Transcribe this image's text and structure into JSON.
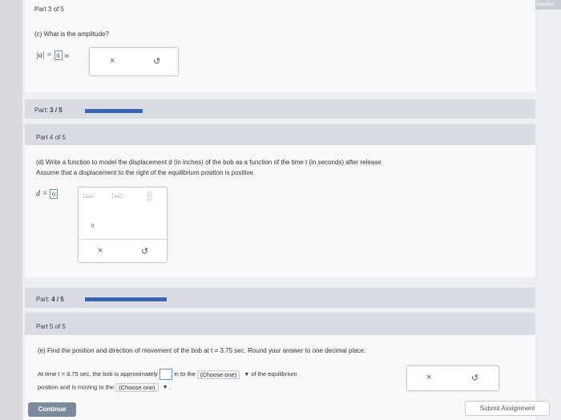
{
  "lang_tab": "Español",
  "part3": {
    "title": "Part 3 of 5",
    "question": "(c) What is the amplitude?",
    "answer_lhs": "|a| =",
    "answer_value": "0",
    "answer_unit": "in"
  },
  "progress1": {
    "label": "Part:",
    "value": "3 / 5",
    "fraction": 0.6
  },
  "part4": {
    "title": "Part 4 of 5",
    "question_line1": "(d) Write a function to model the displacement d (in inches) of the bob as a function of the time t (in seconds) after release.",
    "question_line2": "Assume that a displacement to the right of the equilibrium position is positive.",
    "answer_lhs": "d =",
    "answer_value": "0",
    "pi_symbol": "π"
  },
  "progress2": {
    "label": "Part:",
    "value": "4 / 5",
    "fraction": 0.8
  },
  "part5": {
    "title": "Part 5 of 5",
    "question": "(e) Find the position and direction of movement of the bob at t = 3.75 sec. Round your answer to one decimal place.",
    "line1_prefix": "At time t = 3.75 sec, the bob is approximately",
    "line1_mid": "in to the",
    "select1": "(Choose one)",
    "line1_suffix": "of the equilibrium",
    "line2_prefix": "position and is moving to the",
    "select2": "(Choose one)",
    "line2_suffix": "."
  },
  "buttons": {
    "continue": "Continue",
    "submit": "Submit Assignment",
    "clear": "×",
    "undo": "↺"
  },
  "colors": {
    "progress": "#3b63ad",
    "continue_bg": "#7b8b9b"
  }
}
